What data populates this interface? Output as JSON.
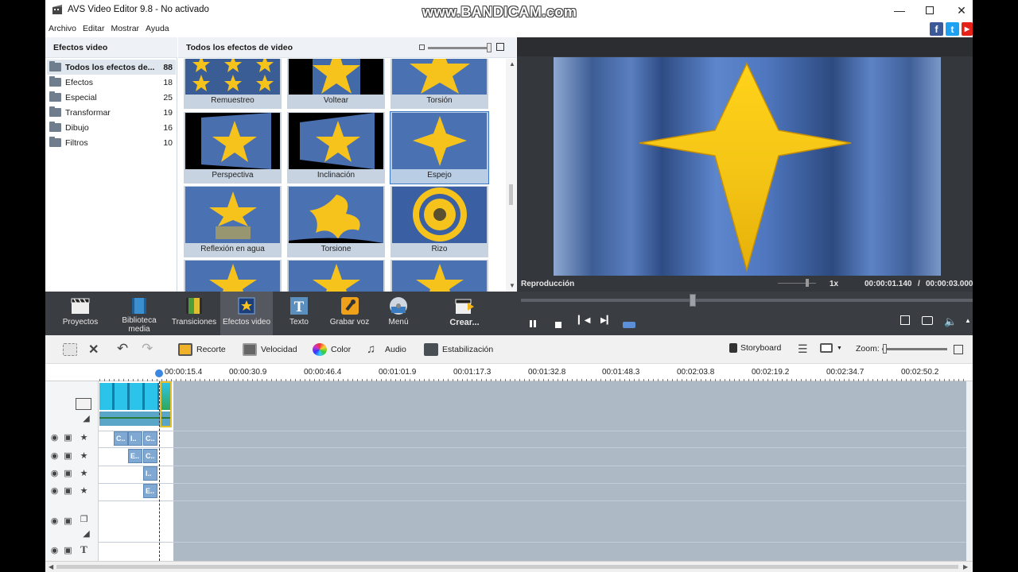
{
  "window": {
    "title": "AVS Video Editor 9.8 - No activado",
    "watermark": "www.BANDICAM.com"
  },
  "menu": [
    "Archivo",
    "Editar",
    "Mostrar",
    "Ayuda"
  ],
  "social": [
    "f",
    "t",
    "yt"
  ],
  "sidebar": {
    "header": "Efectos video",
    "categories": [
      {
        "name": "Todos los efectos de...",
        "count": "88"
      },
      {
        "name": "Efectos",
        "count": "18"
      },
      {
        "name": "Especial",
        "count": "25"
      },
      {
        "name": "Transformar",
        "count": "19"
      },
      {
        "name": "Dibujo",
        "count": "16"
      },
      {
        "name": "Filtros",
        "count": "10"
      }
    ]
  },
  "gallery": {
    "header": "Todos los efectos de video",
    "tiles": [
      {
        "label": "Remuestreo"
      },
      {
        "label": "Voltear"
      },
      {
        "label": "Torsión"
      },
      {
        "label": "Perspectiva"
      },
      {
        "label": "Inclinación"
      },
      {
        "label": "Espejo"
      },
      {
        "label": "Reflexión en agua"
      },
      {
        "label": "Torsione"
      },
      {
        "label": "Rizo"
      },
      {
        "label": ""
      },
      {
        "label": ""
      },
      {
        "label": ""
      }
    ]
  },
  "preview": {
    "label": "Reproducción",
    "speed": "1x",
    "current_time": "00:00:01.140",
    "separator": "/",
    "total_time": "00:00:03.000"
  },
  "toolbar": {
    "buttons": [
      {
        "label": "Proyectos"
      },
      {
        "label": "Biblioteca media"
      },
      {
        "label": "Transiciones"
      },
      {
        "label": "Efectos video"
      },
      {
        "label": "Texto"
      },
      {
        "label": "Grabar voz"
      },
      {
        "label": "Menú"
      },
      {
        "label": "Crear..."
      }
    ]
  },
  "timeline_toolbar": {
    "recorte": "Recorte",
    "velocidad": "Velocidad",
    "color": "Color",
    "audio": "Audio",
    "estabilizacion": "Estabilización",
    "storyboard": "Storyboard",
    "zoom": "Zoom:"
  },
  "ruler": {
    "ticks": [
      "00:00:15.4",
      "00:00:30.9",
      "00:00:46.4",
      "00:01:01.9",
      "00:01:17.3",
      "00:01:32.8",
      "00:01:48.3",
      "00:02:03.8",
      "00:02:19.2",
      "00:02:34.7",
      "00:02:50.2"
    ]
  },
  "effect_clips": {
    "row1": [
      "C..",
      "I..",
      "C.."
    ],
    "row2": [
      "E..",
      "C.."
    ],
    "row3": [
      "I.."
    ],
    "row4": [
      "E.."
    ]
  },
  "colors": {
    "accent": "#3d78c4",
    "toolbar_bg": "#3a3d42",
    "timeline_bg": "#aeb9c6",
    "star": "#f6c21c"
  }
}
